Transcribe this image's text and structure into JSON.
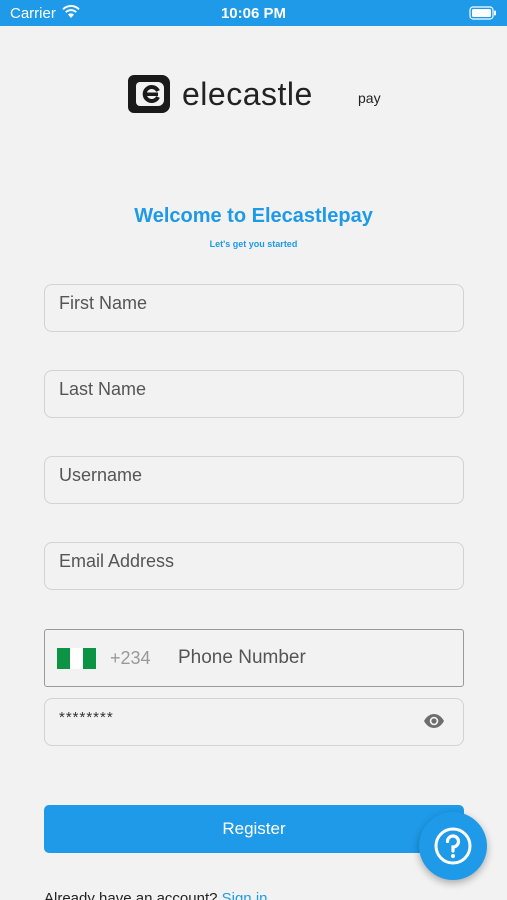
{
  "status_bar": {
    "carrier": "Carrier",
    "time": "10:06 PM"
  },
  "logo": {
    "brand": "elecastle",
    "suffix": "pay"
  },
  "header": {
    "title": "Welcome to Elecastlepay",
    "subtitle": "Let's get you started"
  },
  "form": {
    "first_name_placeholder": "First Name",
    "last_name_placeholder": "Last Name",
    "username_placeholder": "Username",
    "email_placeholder": "Email Address",
    "phone": {
      "dial_code": "+234",
      "placeholder": "Phone Number",
      "flag_colors": [
        "#0b9444",
        "#ffffff",
        "#0b9444"
      ]
    },
    "password_value": "********",
    "password_icon": "eye-icon",
    "register_label": "Register"
  },
  "footer": {
    "prompt": "Already have an account?",
    "signin_label": "Sign in"
  },
  "help_icon": "question-circle-icon",
  "colors": {
    "accent": "#1e9ae8",
    "background": "#f2f2f2"
  }
}
